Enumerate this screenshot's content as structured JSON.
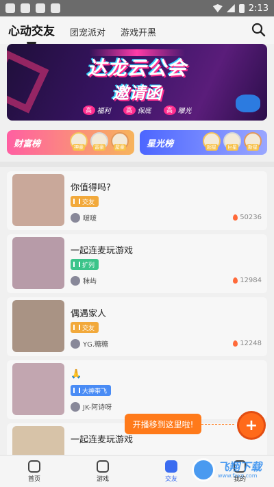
{
  "status_bar": {
    "time": "2:13"
  },
  "top_nav": {
    "tabs": [
      {
        "label": "心动交友",
        "active": true
      },
      {
        "label": "团宠派对",
        "active": false
      },
      {
        "label": "游戏开黑",
        "active": false
      }
    ]
  },
  "banner": {
    "title": "达龙云公会",
    "subtitle": "邀请函",
    "tags": [
      {
        "mark": "高",
        "text": "福利"
      },
      {
        "mark": "高",
        "text": "保底"
      },
      {
        "mark": "高",
        "text": "曝光"
      }
    ]
  },
  "rank_boards": [
    {
      "title": "财富榜",
      "avatars": [
        "神豪",
        "富豪",
        "屋豪"
      ]
    },
    {
      "title": "星光榜",
      "avatars": [
        "超星",
        "巨星",
        "新星"
      ]
    }
  ],
  "rooms": [
    {
      "name": "你值得吗?",
      "tag": "交友",
      "tag_color": "#f2a93b",
      "host": "啵啵",
      "heat": "50236",
      "thumb_color": "#c9a89a"
    },
    {
      "name": "一起连麦玩游戏",
      "tag": "扩列",
      "tag_color": "#3cc48a",
      "host": "秣屿",
      "heat": "12984",
      "thumb_color": "#b79ba8"
    },
    {
      "name": "偶遇家人",
      "tag": "交友",
      "tag_color": "#f2a93b",
      "host": "YG.糖糖",
      "heat": "12248",
      "thumb_color": "#a99384"
    },
    {
      "name": "🙏",
      "tag": "大神带飞",
      "tag_color": "#4a8cf5",
      "host": "JK-阿诗呀",
      "heat": "",
      "thumb_color": "#c2a6b0"
    },
    {
      "name": "一起连麦玩游戏",
      "tag": "",
      "tag_color": "#f2a93b",
      "host": "",
      "heat": "",
      "thumb_color": "#d7c3a8"
    }
  ],
  "toast": {
    "text": "开播移到这里啦!"
  },
  "fab": {
    "symbol": "+"
  },
  "bottom_nav": [
    {
      "label": "首页",
      "active": false
    },
    {
      "label": "游戏",
      "active": false
    },
    {
      "label": "交友",
      "active": true
    },
    {
      "label": "我的",
      "active": false
    }
  ],
  "watermark": {
    "text": "飞翔下载",
    "sub": "www.fxxz.com"
  }
}
